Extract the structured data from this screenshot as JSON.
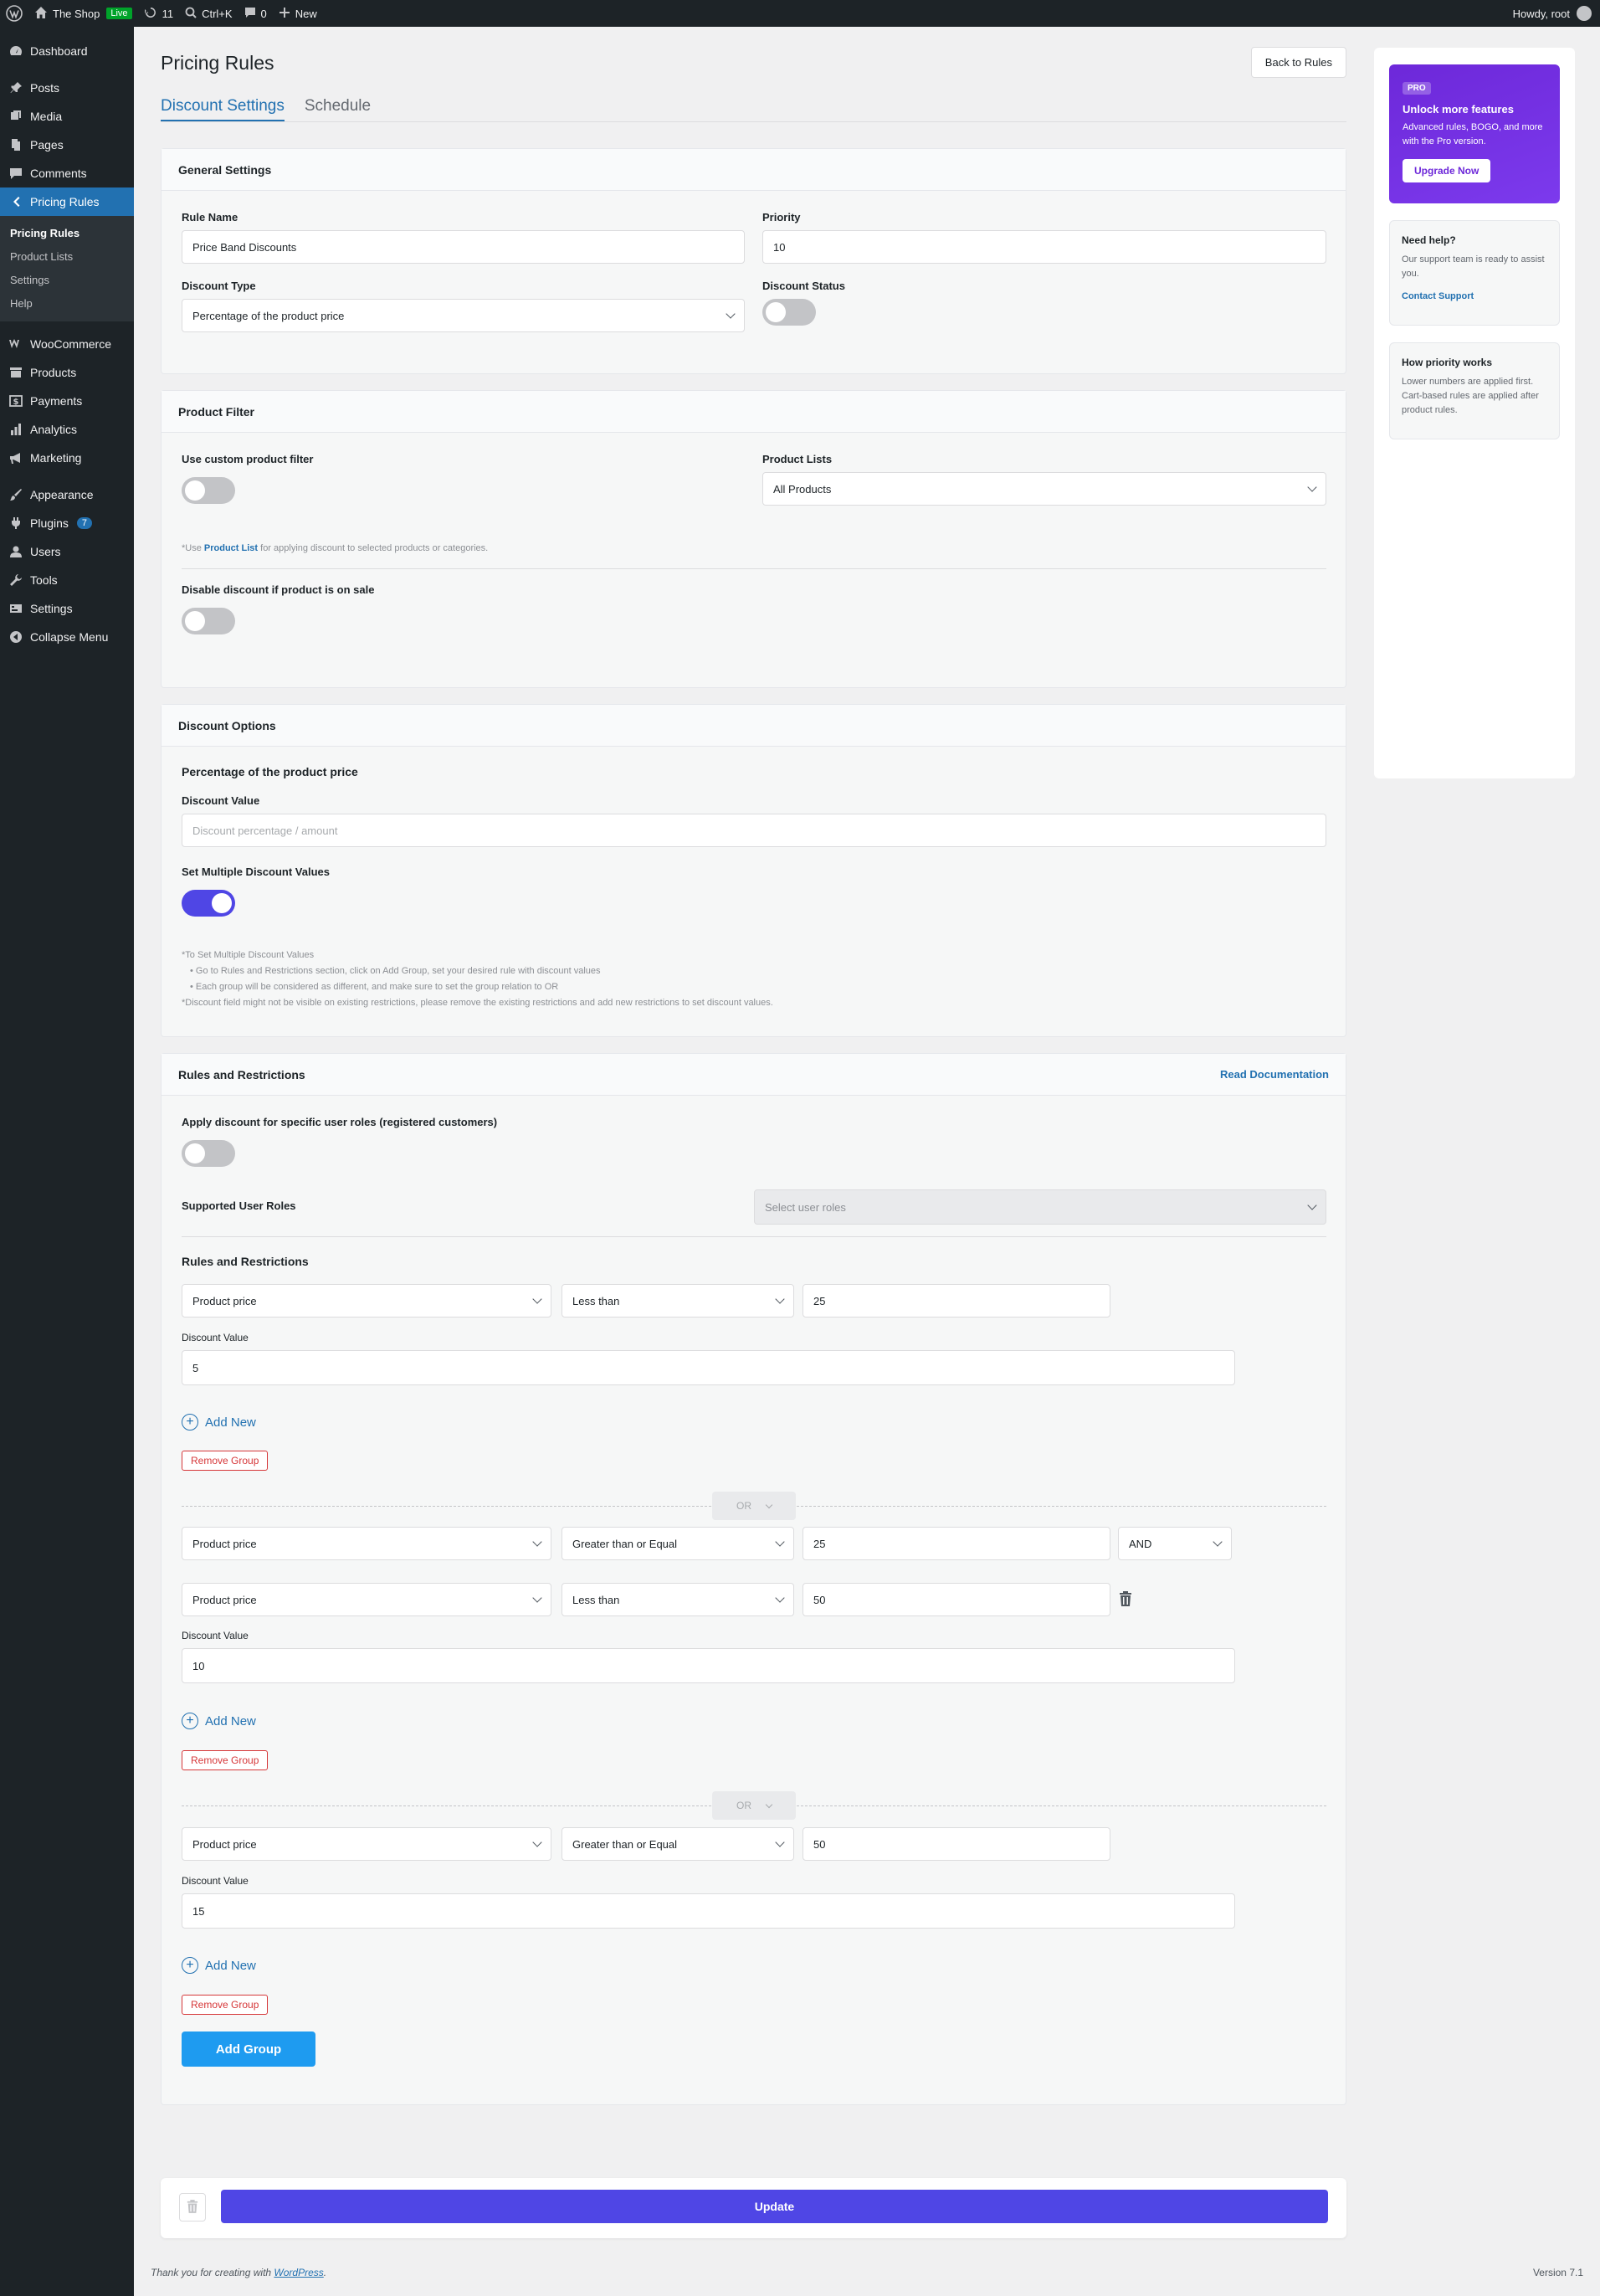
{
  "adminbar": {
    "site_name": "The Shop",
    "live_badge": "Live",
    "updates_count": "11",
    "shortcut": "Ctrl+K",
    "comments_count": "0",
    "new_label": "New",
    "howdy": "Howdy, root"
  },
  "sidebar": {
    "items": [
      {
        "label": "Dashboard",
        "icon": "dashboard-icon"
      },
      {
        "label": "Posts",
        "icon": "pin-icon"
      },
      {
        "label": "Media",
        "icon": "media-icon"
      },
      {
        "label": "Pages",
        "icon": "pages-icon"
      },
      {
        "label": "Comments",
        "icon": "comment-icon"
      },
      {
        "label": "Pricing Rules",
        "icon": "tag-icon"
      },
      {
        "label": "WooCommerce",
        "icon": "woo-icon"
      },
      {
        "label": "Products",
        "icon": "archive-icon"
      },
      {
        "label": "Payments",
        "icon": "dollar-icon"
      },
      {
        "label": "Analytics",
        "icon": "chart-icon"
      },
      {
        "label": "Marketing",
        "icon": "megaphone-icon"
      },
      {
        "label": "Appearance",
        "icon": "brush-icon"
      },
      {
        "label": "Plugins",
        "icon": "plug-icon",
        "badge": "7"
      },
      {
        "label": "Users",
        "icon": "users-icon"
      },
      {
        "label": "Tools",
        "icon": "wrench-icon"
      },
      {
        "label": "Settings",
        "icon": "settings-icon"
      },
      {
        "label": "Collapse Menu",
        "icon": "collapse-icon"
      }
    ],
    "submenu": [
      "Pricing Rules",
      "Product Lists",
      "Settings",
      "Help"
    ]
  },
  "page": {
    "title": "Pricing Rules",
    "back_button": "Back to Rules",
    "tabs": [
      "Discount Settings",
      "Schedule"
    ]
  },
  "general": {
    "header": "General Settings",
    "rule_name_label": "Rule Name",
    "rule_name_value": "Price Band Discounts",
    "priority_label": "Priority",
    "priority_value": "10",
    "discount_type_label": "Discount Type",
    "discount_type_value": "Percentage of the product price",
    "discount_status_label": "Discount Status"
  },
  "product_filter": {
    "header": "Product Filter",
    "custom_filter_label": "Use custom product filter",
    "product_lists_label": "Product Lists",
    "product_lists_value": "All Products",
    "note_prefix": "*Use ",
    "note_link": "Product List",
    "note_suffix": " for applying discount to selected products or categories.",
    "disable_sale_label": "Disable discount if product is on sale"
  },
  "discount_options": {
    "header": "Discount Options",
    "subtitle": "Percentage of the product price",
    "discount_value_label": "Discount Value",
    "discount_value_placeholder": "Discount percentage / amount",
    "multiple_label": "Set Multiple Discount Values",
    "notes": [
      "*To Set Multiple Discount Values",
      "• Go to Rules and Restrictions section, click on Add Group, set your desired rule with discount values",
      "• Each group will be considered as different, and make sure to set the group relation to OR",
      "*Discount field might not be visible on existing restrictions, please remove the existing restrictions and add new restrictions to set discount values."
    ]
  },
  "rules": {
    "header": "Rules and Restrictions",
    "read_docs": "Read Documentation",
    "user_roles_label": "Apply discount for specific user roles (registered customers)",
    "supported_roles_label": "Supported User Roles",
    "supported_roles_placeholder": "Select user roles",
    "section_title": "Rules and Restrictions",
    "discount_value_label": "Discount Value",
    "add_new": "Add New",
    "remove_group": "Remove Group",
    "or_label": "OR",
    "add_group": "Add Group",
    "groups": [
      {
        "conditions": [
          {
            "field": "Product price",
            "operator": "Less than",
            "value": "25"
          }
        ],
        "discount_value": "5"
      },
      {
        "conditions": [
          {
            "field": "Product price",
            "operator": "Greater than or Equal",
            "value": "25",
            "join": "AND"
          },
          {
            "field": "Product price",
            "operator": "Less than",
            "value": "50"
          }
        ],
        "discount_value": "10"
      },
      {
        "conditions": [
          {
            "field": "Product price",
            "operator": "Greater than or Equal",
            "value": "50"
          }
        ],
        "discount_value": "15"
      }
    ]
  },
  "update_bar": {
    "update_label": "Update"
  },
  "side": {
    "pro_badge": "PRO",
    "promo_title": "Unlock more features",
    "promo_text": "Advanced rules, BOGO, and more with the Pro version.",
    "promo_button": "Upgrade Now",
    "help_title": "Need help?",
    "help_text": "Our support team is ready to assist you.",
    "help_link": "Contact Support",
    "priority_title": "How priority works",
    "priority_text": "Lower numbers are applied first. Cart-based rules are applied after product rules."
  },
  "footer": {
    "thanks_prefix": "Thank you for creating with ",
    "thanks_link": "WordPress",
    "thanks_suffix": ".",
    "version": "Version 7.1"
  },
  "colors": {
    "accent": "#2271b1",
    "toggle_on": "#4f46e5",
    "update_button": "#4f46e5",
    "add_group_button": "#1e9bf0",
    "remove_red": "#d63638",
    "promo_purple": "#7c3aed"
  }
}
